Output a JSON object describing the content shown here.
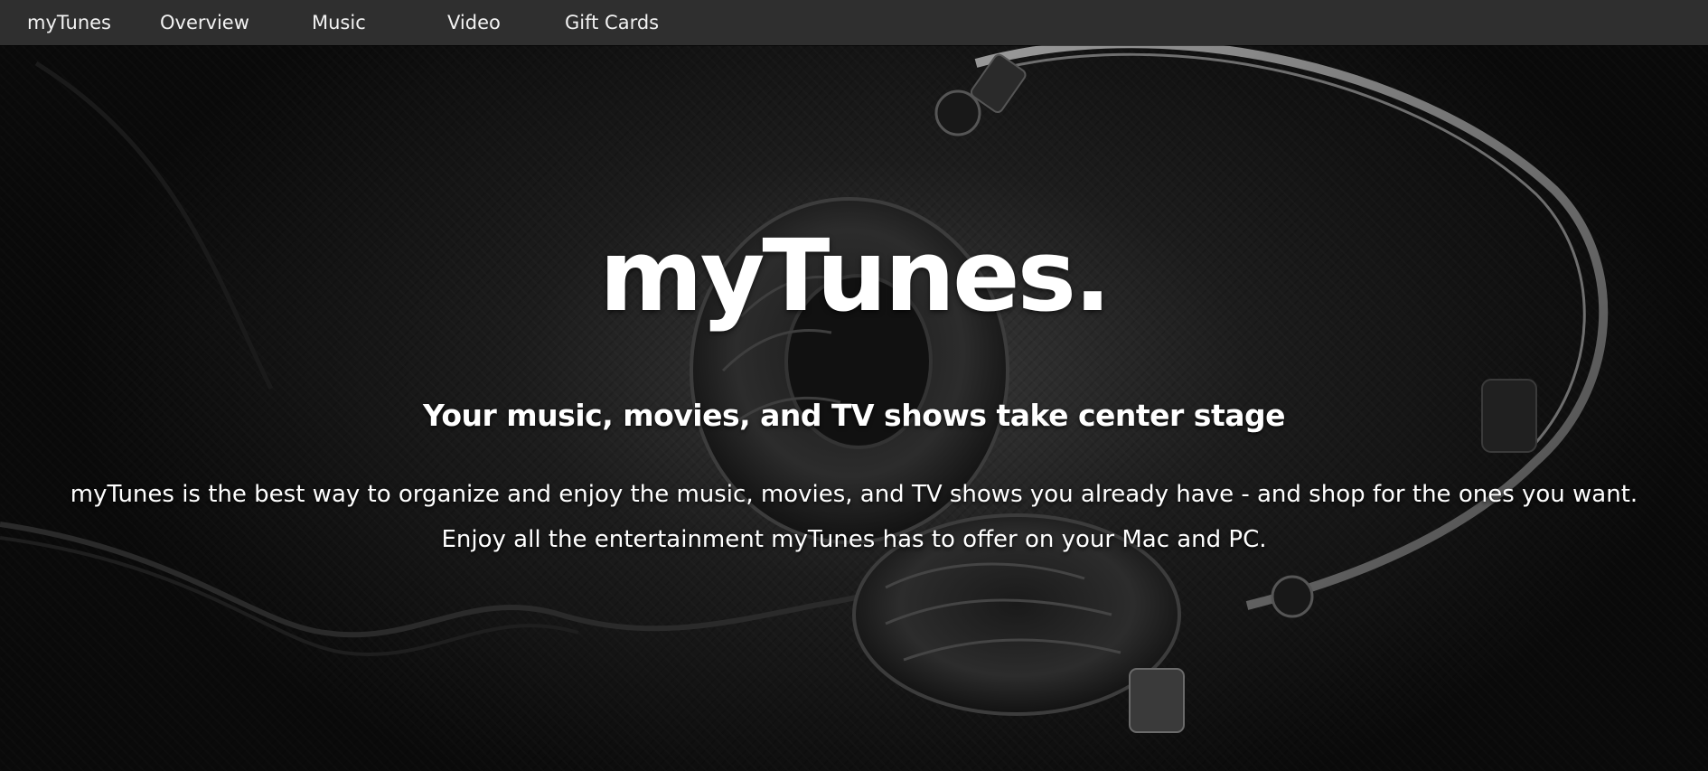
{
  "nav": {
    "brand": "myTunes",
    "items": [
      {
        "label": "Overview"
      },
      {
        "label": "Music"
      },
      {
        "label": "Video"
      },
      {
        "label": "Gift Cards"
      }
    ]
  },
  "hero": {
    "title": "myTunes.",
    "subtitle": "Your music, movies, and TV shows take center stage",
    "description_line1": "myTunes is the best way to organize and enjoy the music, movies, and TV shows you already have - and shop for the ones you want.",
    "description_line2": "Enjoy all the entertainment myTunes has to offer on your Mac and PC.",
    "background_image": "black-headphones-photo"
  },
  "colors": {
    "navbar_bg": "#2f2f2f",
    "nav_text": "#f2f2f2",
    "hero_text": "#ffffff"
  }
}
